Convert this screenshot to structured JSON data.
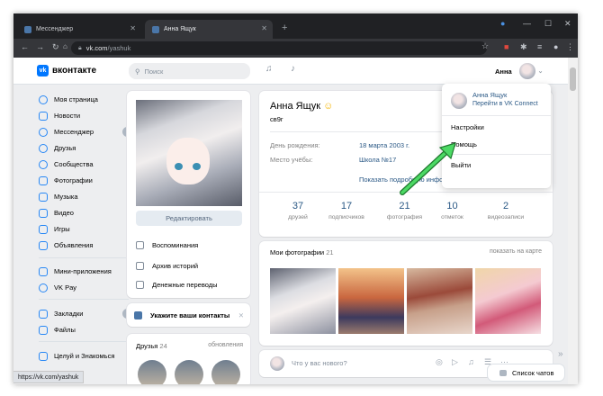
{
  "browser": {
    "tabs": [
      {
        "label": "Мессенджер"
      },
      {
        "label": "Анна Ящук"
      }
    ],
    "new_tab": "+",
    "url_host": "vk.com",
    "url_path": "/yashuk",
    "status_bar_url": "https://vk.com/yashuk"
  },
  "header": {
    "logo_text": "вконтакте",
    "search_placeholder": "Поиск",
    "user_name": "Анна"
  },
  "sidebar": {
    "items": [
      {
        "label": "Моя страница"
      },
      {
        "label": "Новости"
      },
      {
        "label": "Мессенджер",
        "count": "1"
      },
      {
        "label": "Друзья"
      },
      {
        "label": "Сообщества"
      },
      {
        "label": "Фотографии"
      },
      {
        "label": "Музыка"
      },
      {
        "label": "Видео"
      },
      {
        "label": "Игры"
      },
      {
        "label": "Объявления"
      },
      {
        "label": "Мини-приложения"
      },
      {
        "label": "VK Pay"
      },
      {
        "label": "Закладки",
        "count": "1"
      },
      {
        "label": "Файлы"
      },
      {
        "label": "Целуй и Знакомься"
      }
    ]
  },
  "profile_left": {
    "edit_label": "Редактировать",
    "menu": [
      {
        "label": "Воспоминания"
      },
      {
        "label": "Архив историй"
      },
      {
        "label": "Денежные переводы"
      }
    ],
    "contacts_label": "Укажите ваши контакты",
    "friends_label": "Друзья",
    "friends_count": "24",
    "updates_label": "обновления"
  },
  "profile": {
    "name": "Анна Ящук",
    "status": "св9г",
    "rows": [
      {
        "label": "День рождения:",
        "value": "18 марта 2003 г."
      },
      {
        "label": "Место учёбы:",
        "value": "Школа №17"
      }
    ],
    "more_info": "Показать подробную информацию",
    "counters": [
      {
        "value": "37",
        "label": "друзей"
      },
      {
        "value": "17",
        "label": "подписчиков"
      },
      {
        "value": "21",
        "label": "фотография"
      },
      {
        "value": "10",
        "label": "отметок"
      },
      {
        "value": "2",
        "label": "видеозаписи"
      }
    ]
  },
  "photos": {
    "title": "Мои фотографии",
    "count": "21",
    "map_link": "показать на карте"
  },
  "post_box": {
    "placeholder": "Что у вас нового?"
  },
  "dropdown": {
    "name": "Анна Ящук",
    "vk_connect": "Перейти в VK Connect",
    "settings": "Настройки",
    "help": "Помощь",
    "logout": "Выйти"
  },
  "chat": {
    "label": "Список чатов"
  },
  "colors": {
    "accent": "#2a5885",
    "arrow": "#22c55e",
    "bg": "#edeef0"
  }
}
